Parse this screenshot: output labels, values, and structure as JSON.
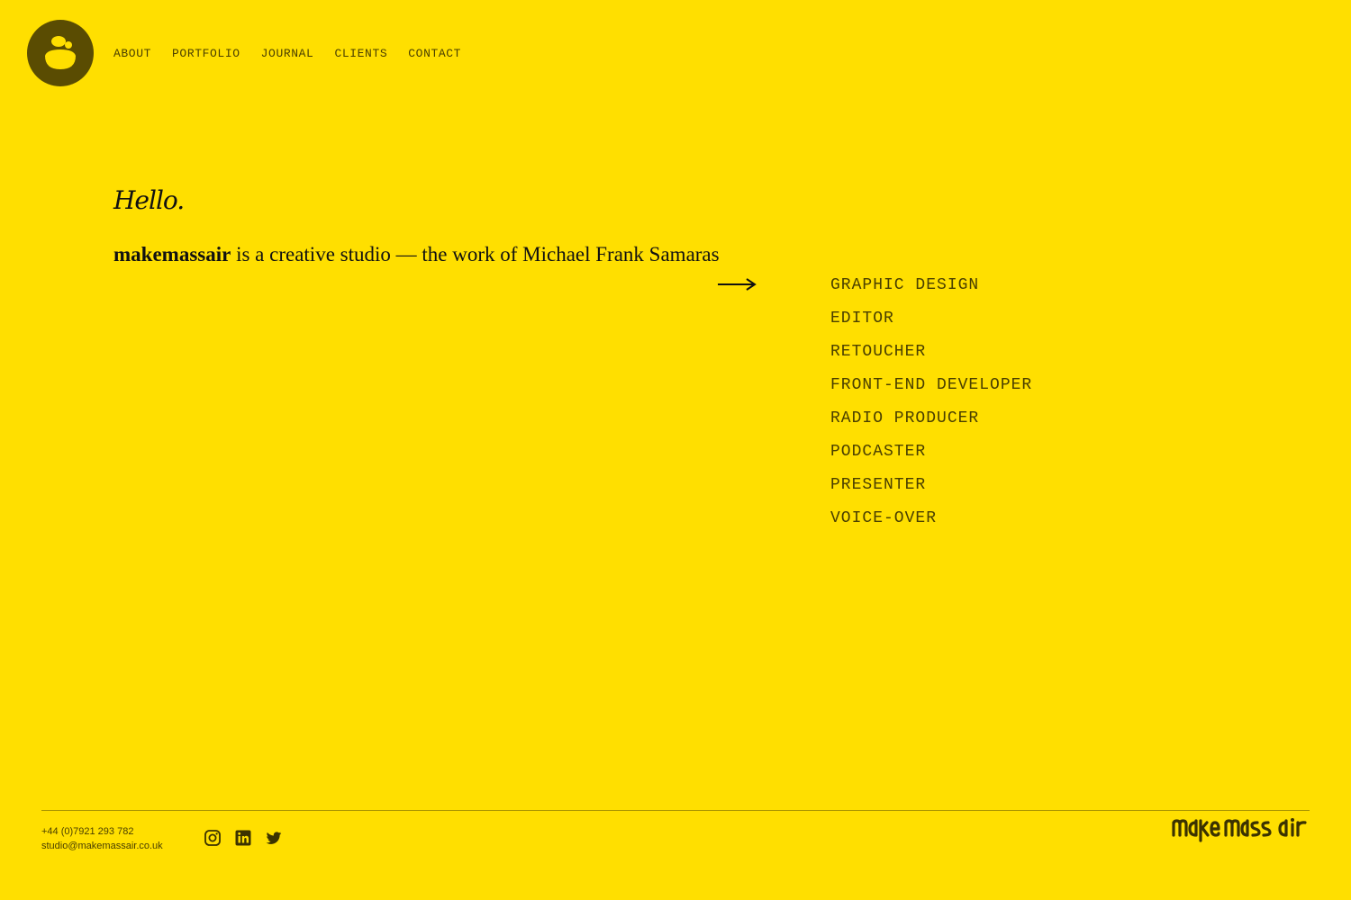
{
  "logo": {
    "icon": "acorn-face-icon",
    "bg": "#5A4C02",
    "fg": "#FFDF00"
  },
  "nav": {
    "items": [
      "ABOUT",
      "PORTFOLIO",
      "JOURNAL",
      "CLIENTS",
      "CONTACT"
    ]
  },
  "hero": {
    "greeting": "Hello.",
    "brand": "makemassair",
    "intro_rest": " is a creative studio — the work of Michael Frank Samaras"
  },
  "arrow_icon": "long-arrow-right-icon",
  "roles": [
    "GRAPHIC DESIGN",
    "EDITOR",
    "RETOUCHER",
    "FRONT-END DEVELOPER",
    "RADIO PRODUCER",
    "PODCASTER",
    "PRESENTER",
    "VOICE-OVER"
  ],
  "footer": {
    "phone": "+44 (0)7921 293 782",
    "email": "studio@makemassair.co.uk",
    "socials": [
      "instagram-icon",
      "linkedin-icon",
      "twitter-icon"
    ],
    "wordmark": "make mass air"
  },
  "colors": {
    "background": "#FFDF00",
    "text": "#111111",
    "muted": "#4A3F00",
    "logo": "#5A4C02"
  }
}
